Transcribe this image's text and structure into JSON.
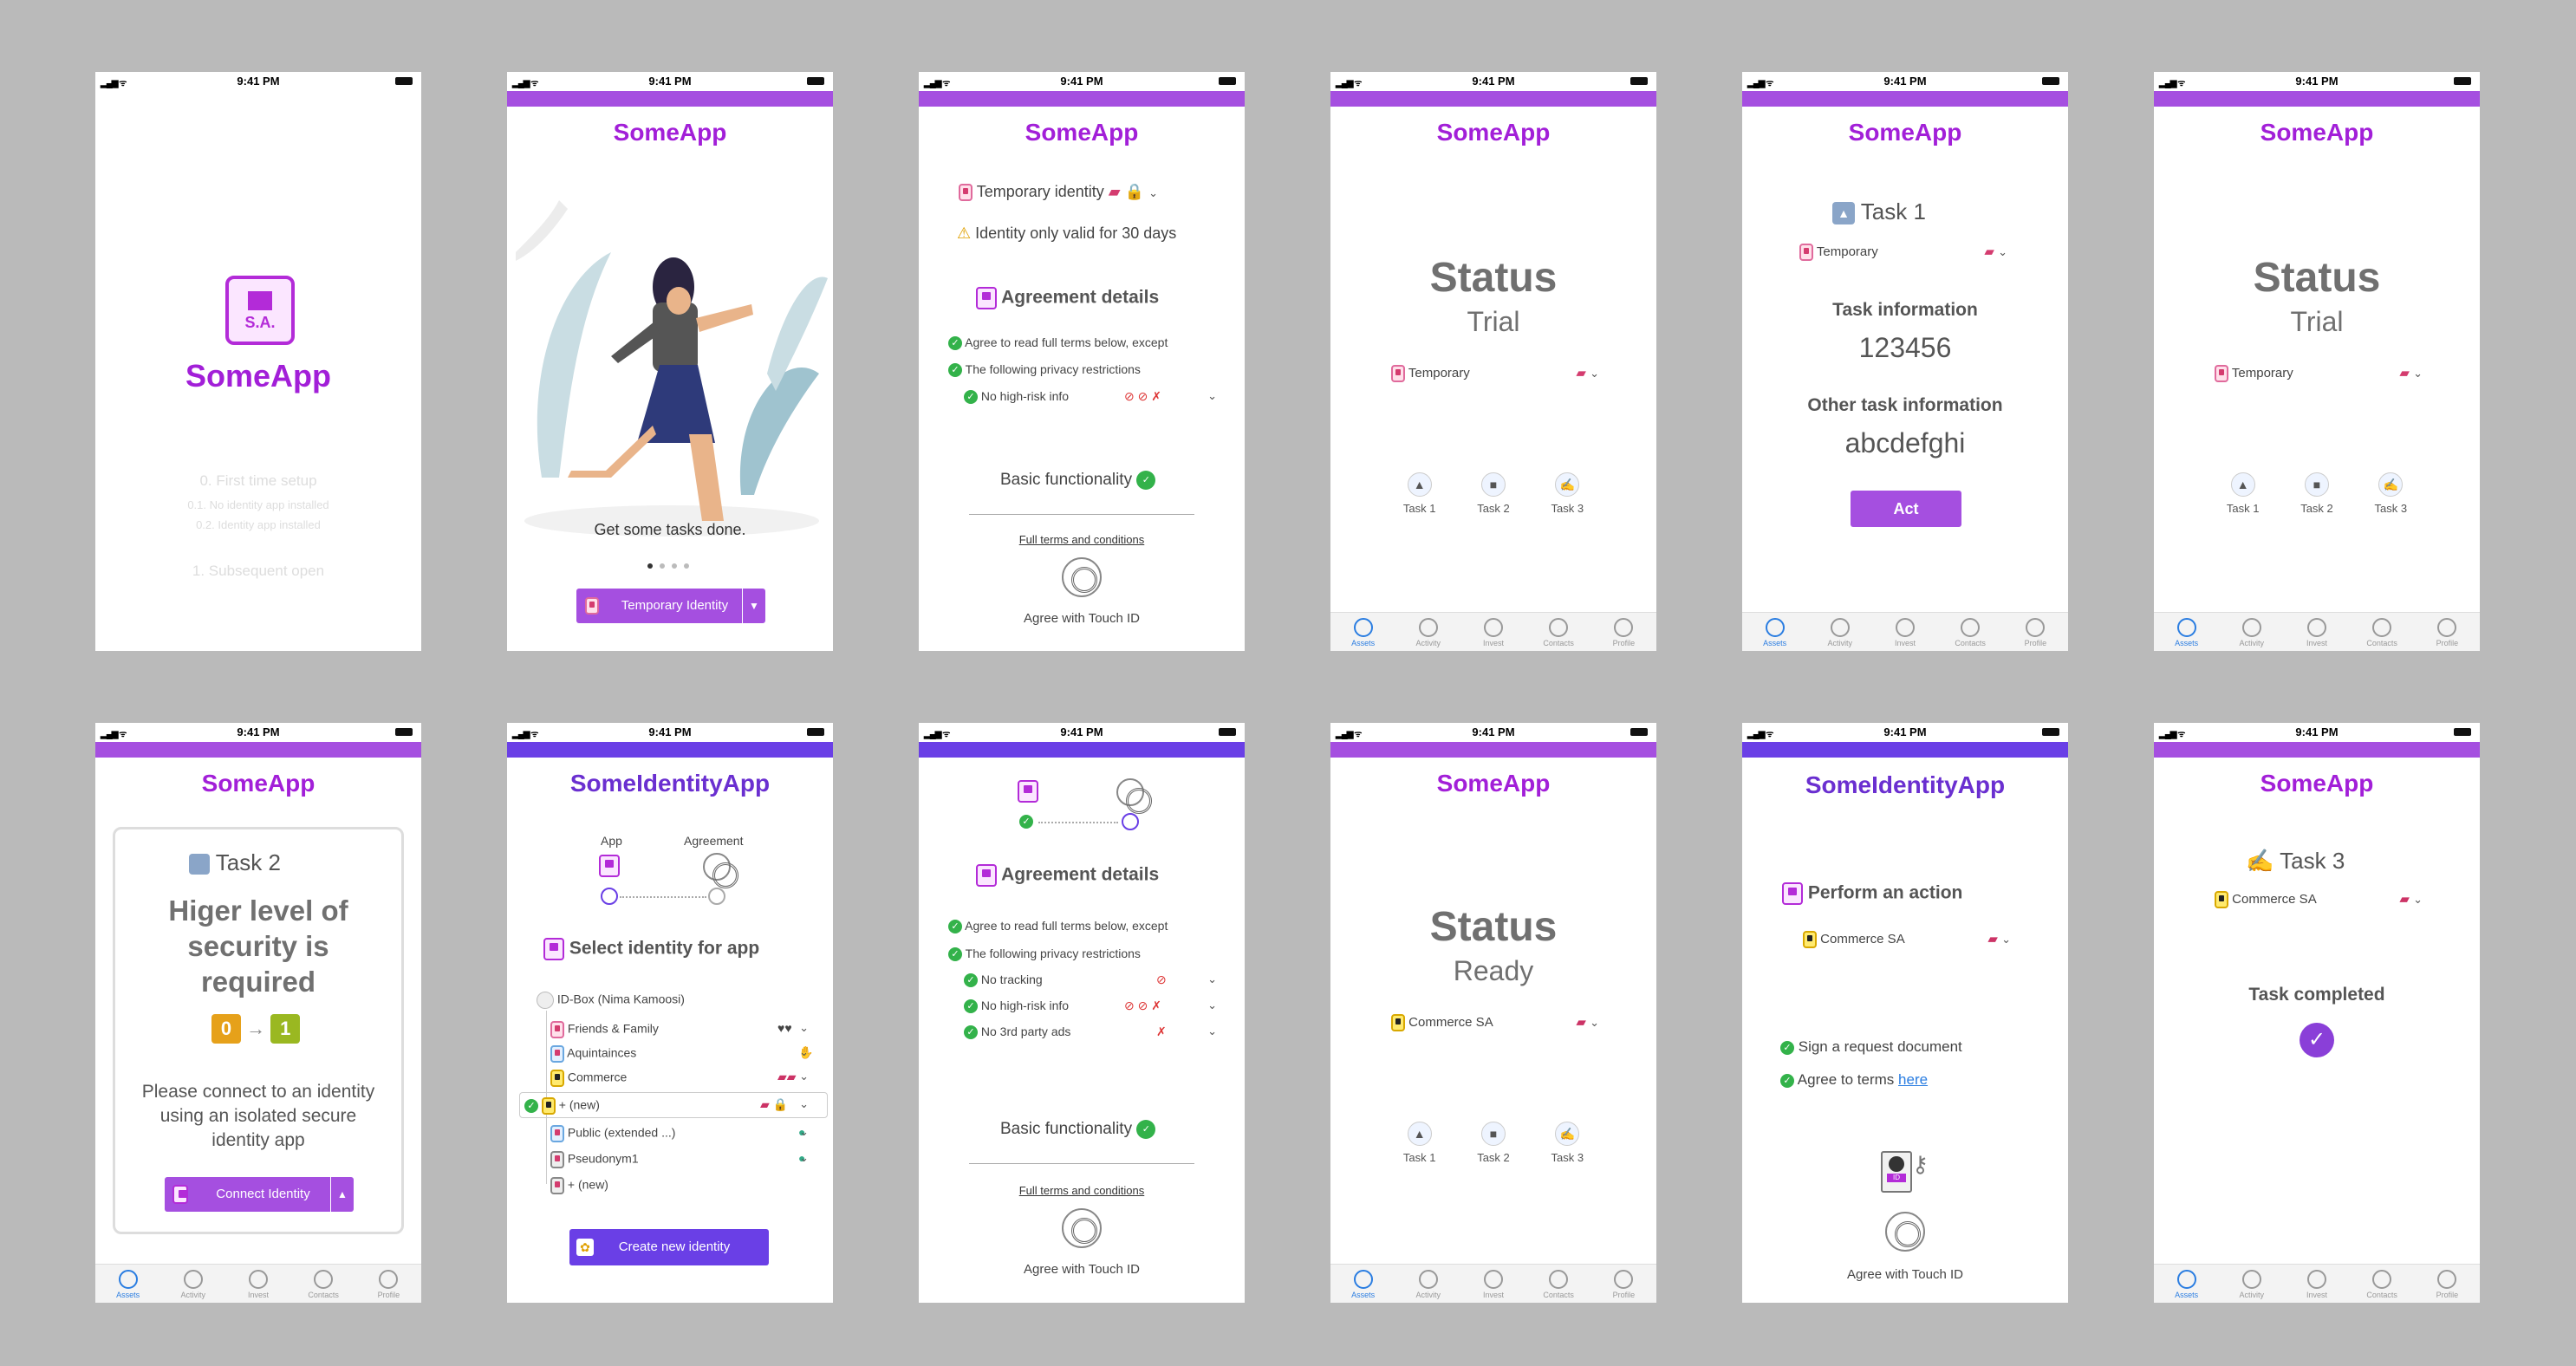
{
  "status_time": "9:41 PM",
  "brand": "SomeApp",
  "identity_brand": "SomeIdentityApp",
  "tabs": [
    "Assets",
    "Activity",
    "Invest",
    "Contacts",
    "Profile"
  ],
  "tasks": [
    "Task 1",
    "Task 2",
    "Task 3"
  ],
  "s1": {
    "logo_initials": "S.A.",
    "menu": [
      "0. First time setup",
      "0.1. No identity app installed",
      "0.2. Identity app installed",
      "1. Subsequent open"
    ]
  },
  "s2": {
    "caption": "Get some tasks done.",
    "button": "Temporary Identity"
  },
  "s3": {
    "identity": "Temporary identity",
    "warning": "Identity only valid for 30 days",
    "agreement_title": "Agreement details",
    "terms": [
      "Agree to read full terms below, except",
      "The following privacy restrictions",
      "No high-risk info"
    ],
    "basic": "Basic functionality",
    "full_terms": "Full terms and conditions",
    "touch": "Agree with Touch ID"
  },
  "s4": {
    "status": "Status",
    "state": "Trial",
    "identity": "Temporary"
  },
  "s5": {
    "task": "Task 1",
    "identity": "Temporary",
    "info_label": "Task information",
    "info_value": "123456",
    "other_label": "Other task information",
    "other_value": "abcdefghi",
    "act": "Act"
  },
  "s7": {
    "task": "Task 2",
    "heading": "Higer level of security is required",
    "lock_from": "0",
    "lock_to": "1",
    "body": "Please connect to an identity using an isolated secure identity app",
    "button": "Connect Identity"
  },
  "s8": {
    "step_app": "App",
    "step_agreement": "Agreement",
    "select_title": "Select identity for app",
    "idbox": "ID-Box (Nima Kamoosi)",
    "identities": [
      "Friends & Family",
      "Aquintainces",
      "Commerce",
      "+ (new)",
      "Public (extended ...)",
      "Pseudonym1",
      "+ (new)"
    ],
    "create": "Create new identity"
  },
  "s9": {
    "terms": [
      "Agree to read full terms below, except",
      "The following privacy restrictions",
      "No tracking",
      "No high-risk info",
      "No 3rd party ads"
    ]
  },
  "s10": {
    "state": "Ready",
    "identity": "Commerce SA"
  },
  "s11": {
    "perform": "Perform an action",
    "identity": "Commerce SA",
    "items": [
      "Sign a request document",
      "Agree to terms"
    ],
    "here": "here",
    "id_badge": "ID"
  },
  "s12": {
    "task": "Task 3",
    "identity": "Commerce SA",
    "completed": "Task completed"
  }
}
